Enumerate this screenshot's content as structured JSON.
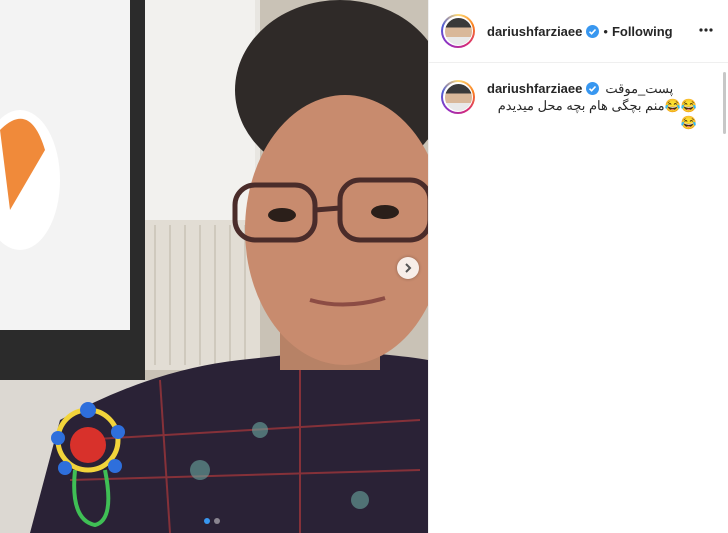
{
  "post": {
    "username": "dariushfarziaee",
    "follow_status": "Following",
    "separator": "•"
  },
  "caption": {
    "username": "dariushfarziaee",
    "line1": "پست_موقت",
    "line2": "منم بچگی هام بچه محل میدیدم",
    "emoji_a": "😂",
    "emoji_b": "😂"
  },
  "carousel": {
    "total": 2,
    "current": 1
  },
  "colors": {
    "verified": "#3897f0",
    "text": "#262626"
  }
}
